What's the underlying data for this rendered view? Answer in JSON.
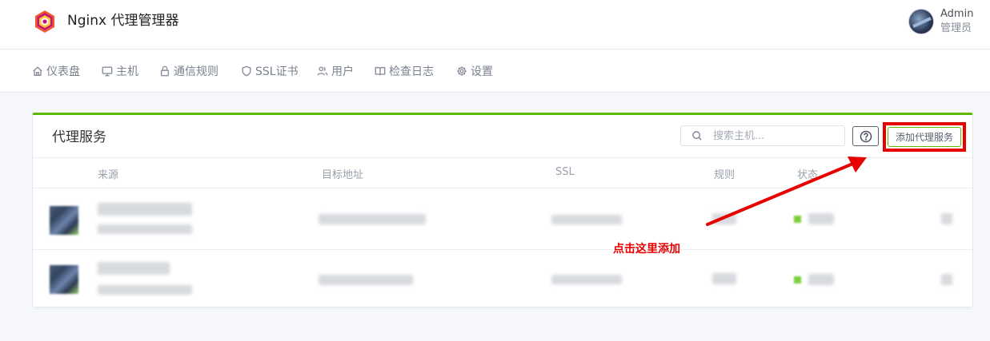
{
  "app": {
    "title": "Nginx 代理管理器"
  },
  "user": {
    "name": "Admin",
    "role": "管理员"
  },
  "nav": [
    {
      "label": "仪表盘",
      "icon": "home-icon"
    },
    {
      "label": "主机",
      "icon": "monitor-icon"
    },
    {
      "label": "通信规则",
      "icon": "lock-icon"
    },
    {
      "label": "SSL证书",
      "icon": "shield-icon"
    },
    {
      "label": "用户",
      "icon": "users-icon"
    },
    {
      "label": "检查日志",
      "icon": "book-icon"
    },
    {
      "label": "设置",
      "icon": "gear-icon"
    }
  ],
  "card": {
    "title": "代理服务",
    "search_placeholder": "搜索主机...",
    "add_label": "添加代理服务"
  },
  "table": {
    "columns": [
      "来源",
      "目标地址",
      "SSL",
      "规则",
      "状态"
    ]
  },
  "annotation": "点击这里添加",
  "colors": {
    "accent_green": "#5eba00",
    "highlight_red": "#e60000"
  }
}
